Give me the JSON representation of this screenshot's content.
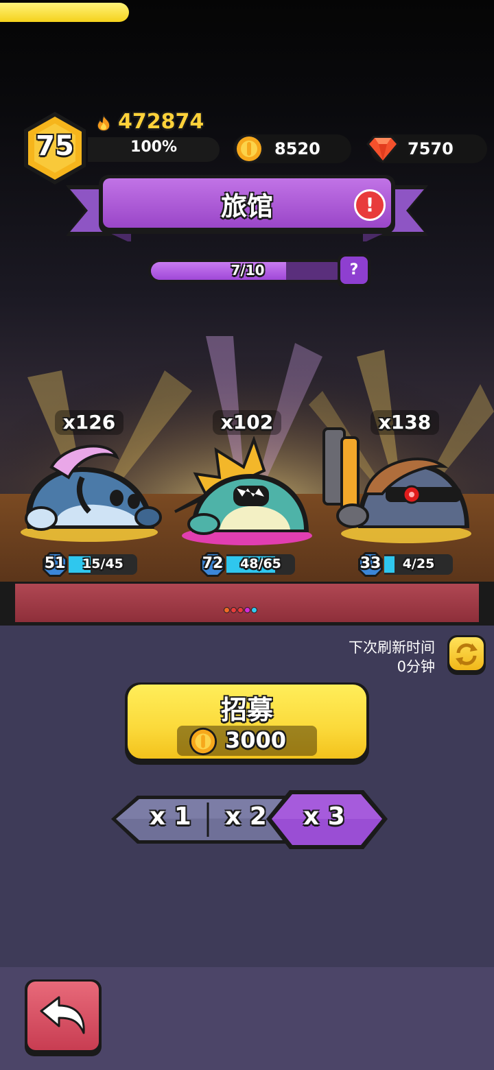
{
  "hud": {
    "level": "75",
    "xp_percent_text": "100%",
    "xp_fraction": 1.0,
    "power": "472874",
    "coins": "8520",
    "gems": "7570"
  },
  "title": {
    "text": "旅馆",
    "alert_glyph": "!"
  },
  "progress": {
    "text": "7/10",
    "current": 7,
    "max": 10,
    "help_glyph": "?"
  },
  "creatures": [
    {
      "count": "x126",
      "level": "51",
      "shards": "15/45",
      "shard_fraction": 0.33
    },
    {
      "count": "x102",
      "level": "72",
      "shards": "48/65",
      "shard_fraction": 0.74
    },
    {
      "count": "x138",
      "level": "33",
      "shards": "4/25",
      "shard_fraction": 0.16
    }
  ],
  "page_dots": [
    "#f06a25",
    "#e83b3b",
    "#e83b3b",
    "#d62ad6",
    "#35c8ef"
  ],
  "refresh": {
    "label": "下次刷新时间",
    "time": "0分钟"
  },
  "recruit": {
    "label": "招募",
    "cost": "3000"
  },
  "multipliers": {
    "options": [
      "x 1",
      "x 2",
      "x 3"
    ],
    "selected": "x 3"
  },
  "icons": {
    "flame": "flame-icon",
    "coin": "coin-icon",
    "gem": "gem-icon",
    "refresh": "refresh-icon",
    "back": "back-arrow-icon"
  }
}
